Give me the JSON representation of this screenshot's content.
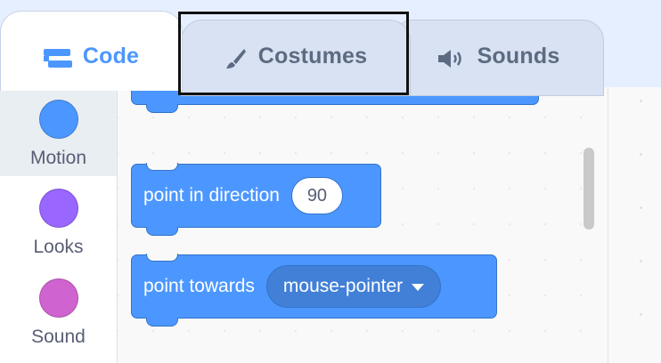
{
  "tabs": [
    {
      "label": "Code",
      "icon": "code-blocks-icon",
      "active": true
    },
    {
      "label": "Costumes",
      "icon": "paintbrush-icon",
      "active": false
    },
    {
      "label": "Sounds",
      "icon": "speaker-icon",
      "active": false
    }
  ],
  "categories": [
    {
      "label": "Motion",
      "color": "#4c97ff",
      "selected": true
    },
    {
      "label": "Looks",
      "color": "#9966ff",
      "selected": false
    },
    {
      "label": "Sound",
      "color": "#cf63cf",
      "selected": false
    }
  ],
  "blocks": {
    "point_in_direction": {
      "label": "point in direction",
      "value": "90"
    },
    "point_towards": {
      "label": "point towards",
      "value": "mouse-pointer"
    }
  },
  "colors": {
    "motion": "#4c97ff",
    "highlight_border": "#111111"
  }
}
